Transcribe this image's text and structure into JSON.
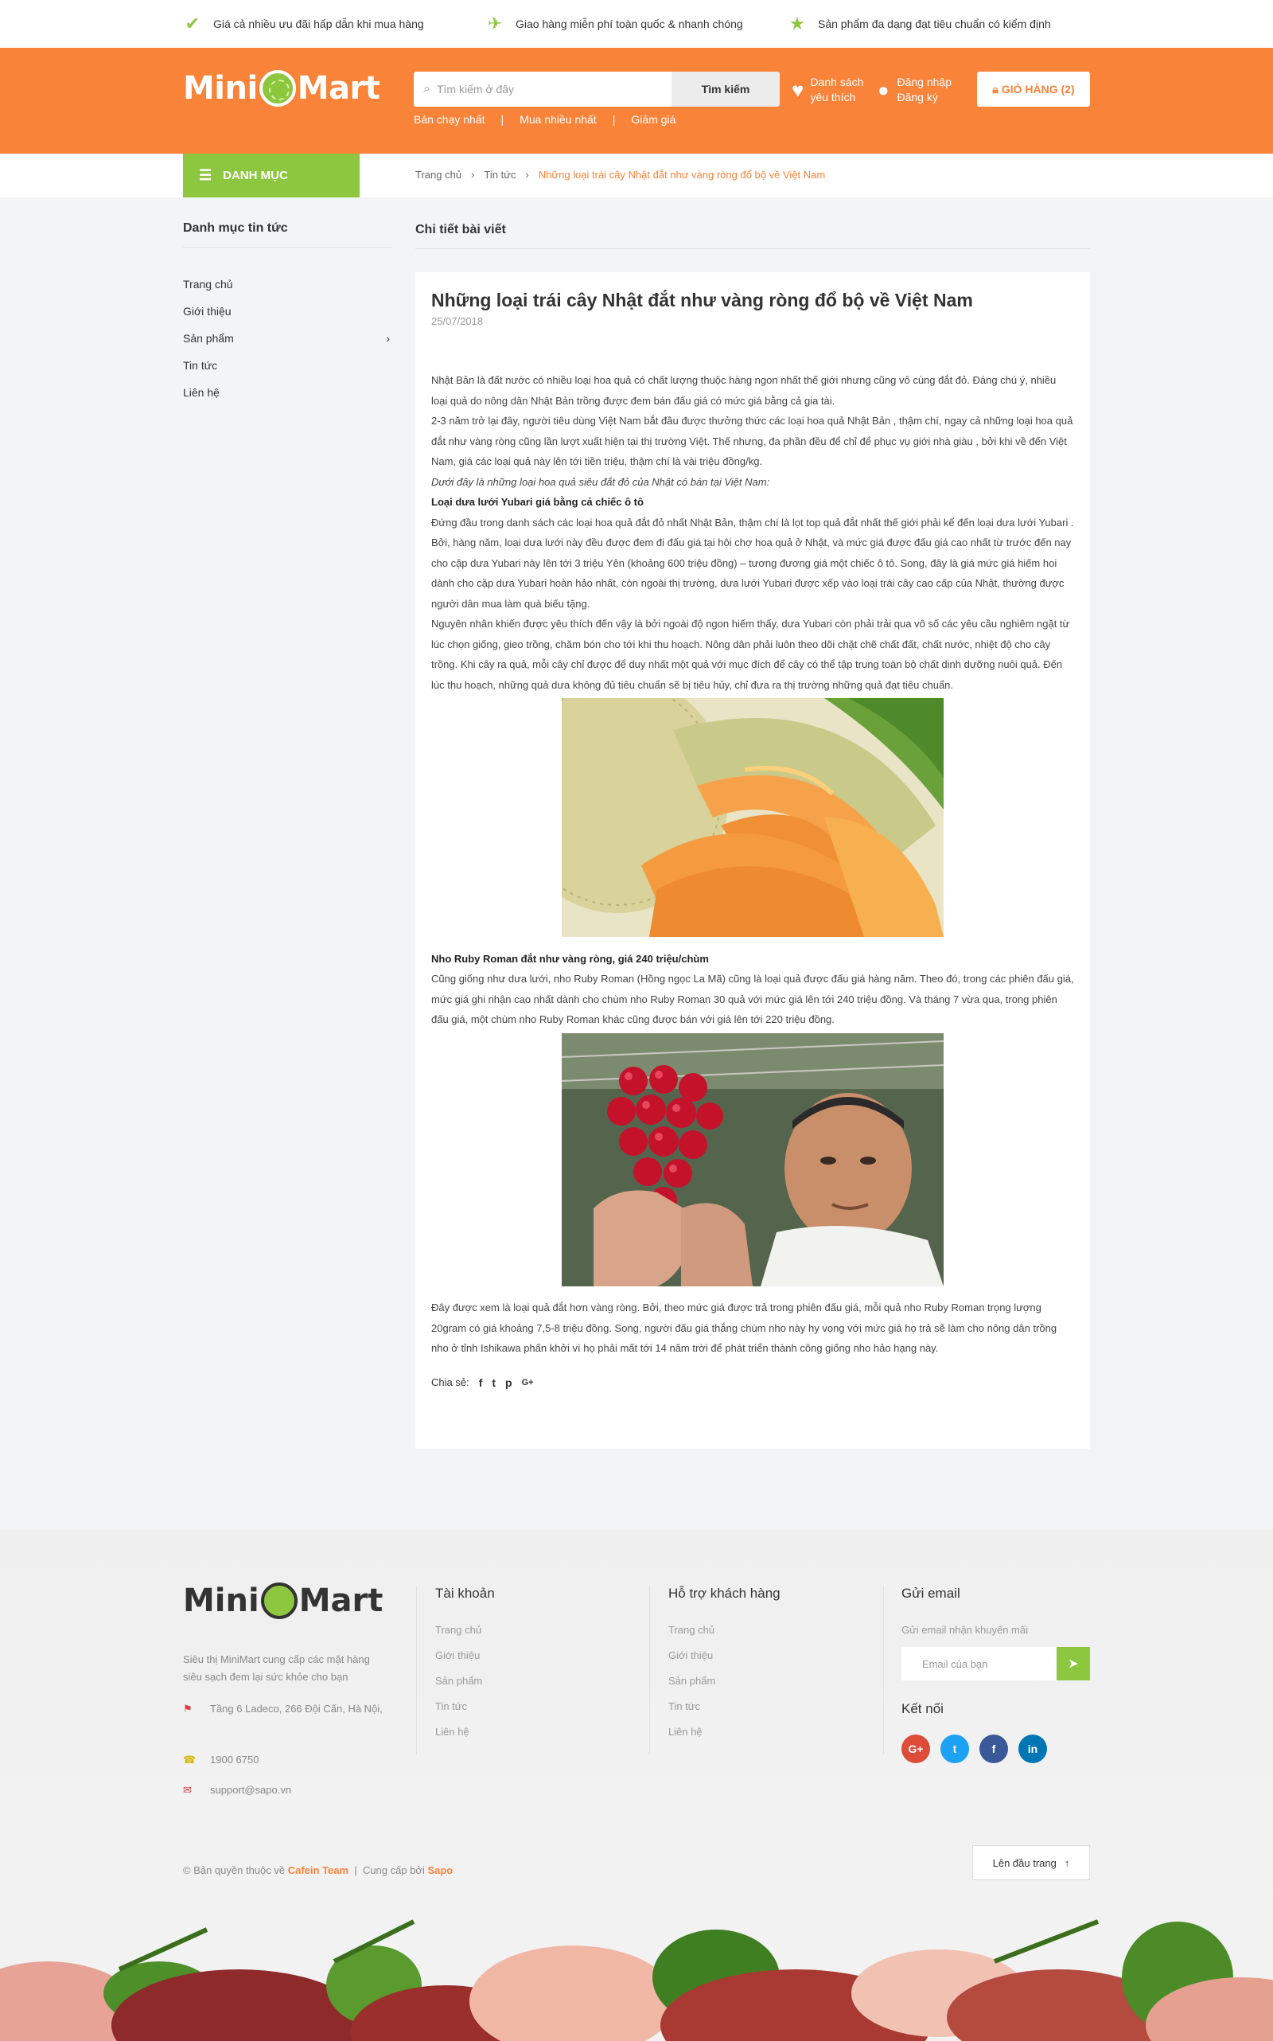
{
  "topbar": {
    "perks": [
      {
        "icon": "check-icon",
        "text": "Giá cả nhiều ưu đãi hấp dẫn khi mua hàng"
      },
      {
        "icon": "plane-icon",
        "text": "Giao hàng miễn phí toàn quốc & nhanh chóng"
      },
      {
        "icon": "star-icon",
        "text": "Sản phẩm đa dạng đạt tiêu chuẩn có kiểm định"
      }
    ]
  },
  "header": {
    "logo_left": "Mini",
    "logo_right": "Mart",
    "search_placeholder": "Tìm kiếm ở đây",
    "search_button": "Tìm kiếm",
    "quick_links": [
      "Bán chạy nhất",
      "Mua nhiều nhất",
      "Giảm giá"
    ],
    "wishlist_line1": "Danh sách",
    "wishlist_line2": "yêu thích",
    "login": "Đăng nhập",
    "register": "Đăng ký",
    "cart": "GIỎ HÀNG (2)"
  },
  "nav": {
    "category_button": "DANH MỤC",
    "breadcrumb": [
      "Trang chủ",
      "Tin tức",
      "Những loại trái cây Nhật đắt như vàng ròng đổ bộ về Việt Nam"
    ]
  },
  "sidebar": {
    "title": "Danh mục tin tức",
    "items": [
      "Trang chủ",
      "Giới thiệu",
      "Sản phẩm",
      "Tin tức",
      "Liên hệ"
    ]
  },
  "main": {
    "section_title": "Chi tiết bài viết",
    "article": {
      "title": "Những loại trái cây Nhật đắt như vàng ròng đổ bộ về Việt Nam",
      "date": "25/07/2018",
      "p1": "Nhật Bản là đất nước có nhiều loại hoa quả có chất lượng thuộc hàng ngon nhất thế giới nhưng cũng vô cùng đắt đỏ. Đáng chú ý, nhiều loại quả do nông dân Nhật Bản trồng được đem bán đấu giá có mức giá bằng cả gia tài.",
      "p2": "2-3 năm trở lại đây, người tiêu dùng Việt Nam bắt đầu được thưởng thức các loại hoa quả Nhật Bản , thậm chí, ngay cả những loại hoa quả đắt như vàng ròng cũng lần lượt xuất hiện tại thị trường Việt. Thế nhưng, đa phần đều để chỉ để phục vụ giới nhà giàu , bởi khi về đến Việt Nam, giá các loại quả này lên tới tiền triệu, thậm chí là vài triệu đồng/kg.",
      "p3": "Dưới đây là những loại hoa quả siêu đắt đỏ của Nhật có bán tại Việt Nam:",
      "h1": "Loại dưa lưới Yubari giá bằng cả chiếc ô tô",
      "p4": "Đứng đầu trong danh sách các loại hoa quả đắt đỏ nhất Nhật Bản, thậm chí là lọt top quả đắt nhất thế giới phải kể đến loại dưa lưới Yubari . Bởi, hàng năm, loại dưa lưới này đều được đem đi đấu giá tại hội chợ hoa quả ở Nhật, và mức giá được đấu giá cao nhất từ trước đến nay cho cặp dưa Yubari này lên tới 3 triệu Yên (khoảng 600 triệu đồng) – tương đương giá một chiếc ô tô. Song, đây là giá mức giá hiếm hoi dành cho cặp dưa Yubari hoàn hảo nhất, còn ngoài thị trường, dưa lưới Yubari được xếp vào loại trái cây cao cấp của Nhật, thường được người dân mua làm quà biếu tặng.",
      "p5": "Nguyên nhân khiến được yêu thích đến vậy là bởi ngoài độ ngon hiếm thấy, dưa Yubari còn phải trải qua vô số các yêu cầu nghiêm ngặt từ lúc chọn giống, gieo trồng, chăm bón cho tới khi thu hoạch. Nông dân phải luôn theo dõi chặt chẽ chất đất, chất nước, nhiệt độ cho cây trồng. Khi cây ra quả, mỗi cây chỉ được để duy nhất một quả với mục đích để cây có thể tập trung toàn bộ chất dinh dưỡng nuôi quả. Đến lúc thu hoạch, những quả dưa không đủ tiêu chuẩn sẽ bị tiêu hủy, chỉ đưa ra thị trường những quả đạt tiêu chuẩn.",
      "h2": "Nho Ruby Roman đắt như vàng ròng, giá 240 triệu/chùm",
      "p6": "Cũng giống như dưa lưới, nho Ruby Roman (Hồng ngọc La Mã) cũng là loại quả được đấu giá hàng năm. Theo đó, trong các phiên đấu giá, mức giá ghi nhận cao nhất dành cho chùm nho Ruby Roman 30 quả với mức giá lên tới 240 triệu đồng. Và tháng 7 vừa qua, trong phiên đấu giá, một chùm nho Ruby Roman khác cũng được bán với giá lên tới 220 triệu đồng.",
      "p7": "Đây được xem là loại quả đắt hơn vàng ròng. Bởi, theo mức giá được trả trong phiên đấu giá, mỗi quả nho Ruby Roman trọng lượng 20gram có giá khoảng 7,5-8 triệu đồng. Song, người đấu giá thắng chùm nho này hy vọng với mức giá họ trả sẽ làm cho nông dân trồng nho ở tỉnh Ishikawa phấn khởi vì họ phải mất tới 14 năm trời để phát triển thành công giống nho hảo hạng này.",
      "share_label": "Chia sẻ:",
      "share_icons": [
        "facebook-icon",
        "twitter-icon",
        "pinterest-icon",
        "google-plus-icon"
      ]
    }
  },
  "footer": {
    "logo_left": "Mini",
    "logo_right": "Mart",
    "desc": "Siêu thị MiniMart cung cấp các mặt hàng siêu sạch đem lại sức khỏe cho bạn",
    "address": "Tầng 6 Ladeco, 266 Đội Cấn, Hà Nội,",
    "phone": "1900 6750",
    "email": "support@sapo.vn",
    "col1": {
      "title": "Tài khoản",
      "items": [
        "Trang chủ",
        "Giới thiệu",
        "Sản phẩm",
        "Tin tức",
        "Liên hệ"
      ]
    },
    "col2": {
      "title": "Hỗ trợ khách hàng",
      "items": [
        "Trang chủ",
        "Giới thiệu",
        "Sản phẩm",
        "Tin tức",
        "Liên hệ"
      ]
    },
    "mail_title": "Gửi email",
    "mail_sub": "Gửi email nhận khuyến mãi",
    "mail_placeholder": "Email của bạn",
    "connect_title": "Kết nối",
    "socials": [
      {
        "name": "google-plus-icon",
        "glyph": "G+",
        "color": "#dd4b39"
      },
      {
        "name": "twitter-icon",
        "glyph": "t",
        "color": "#1da1f2"
      },
      {
        "name": "facebook-icon",
        "glyph": "f",
        "color": "#3b5998"
      },
      {
        "name": "linkedin-icon",
        "glyph": "in",
        "color": "#0077b5"
      }
    ],
    "copyright_prefix": "© Bản quyền thuộc về",
    "copyright_team": "Cafein Team",
    "provider_prefix": "Cung cấp bởi",
    "provider": "Sapo",
    "back_to_top": "Lên đầu trang"
  },
  "colors": {
    "brand": "#f98339",
    "accent": "#8dc63f"
  }
}
